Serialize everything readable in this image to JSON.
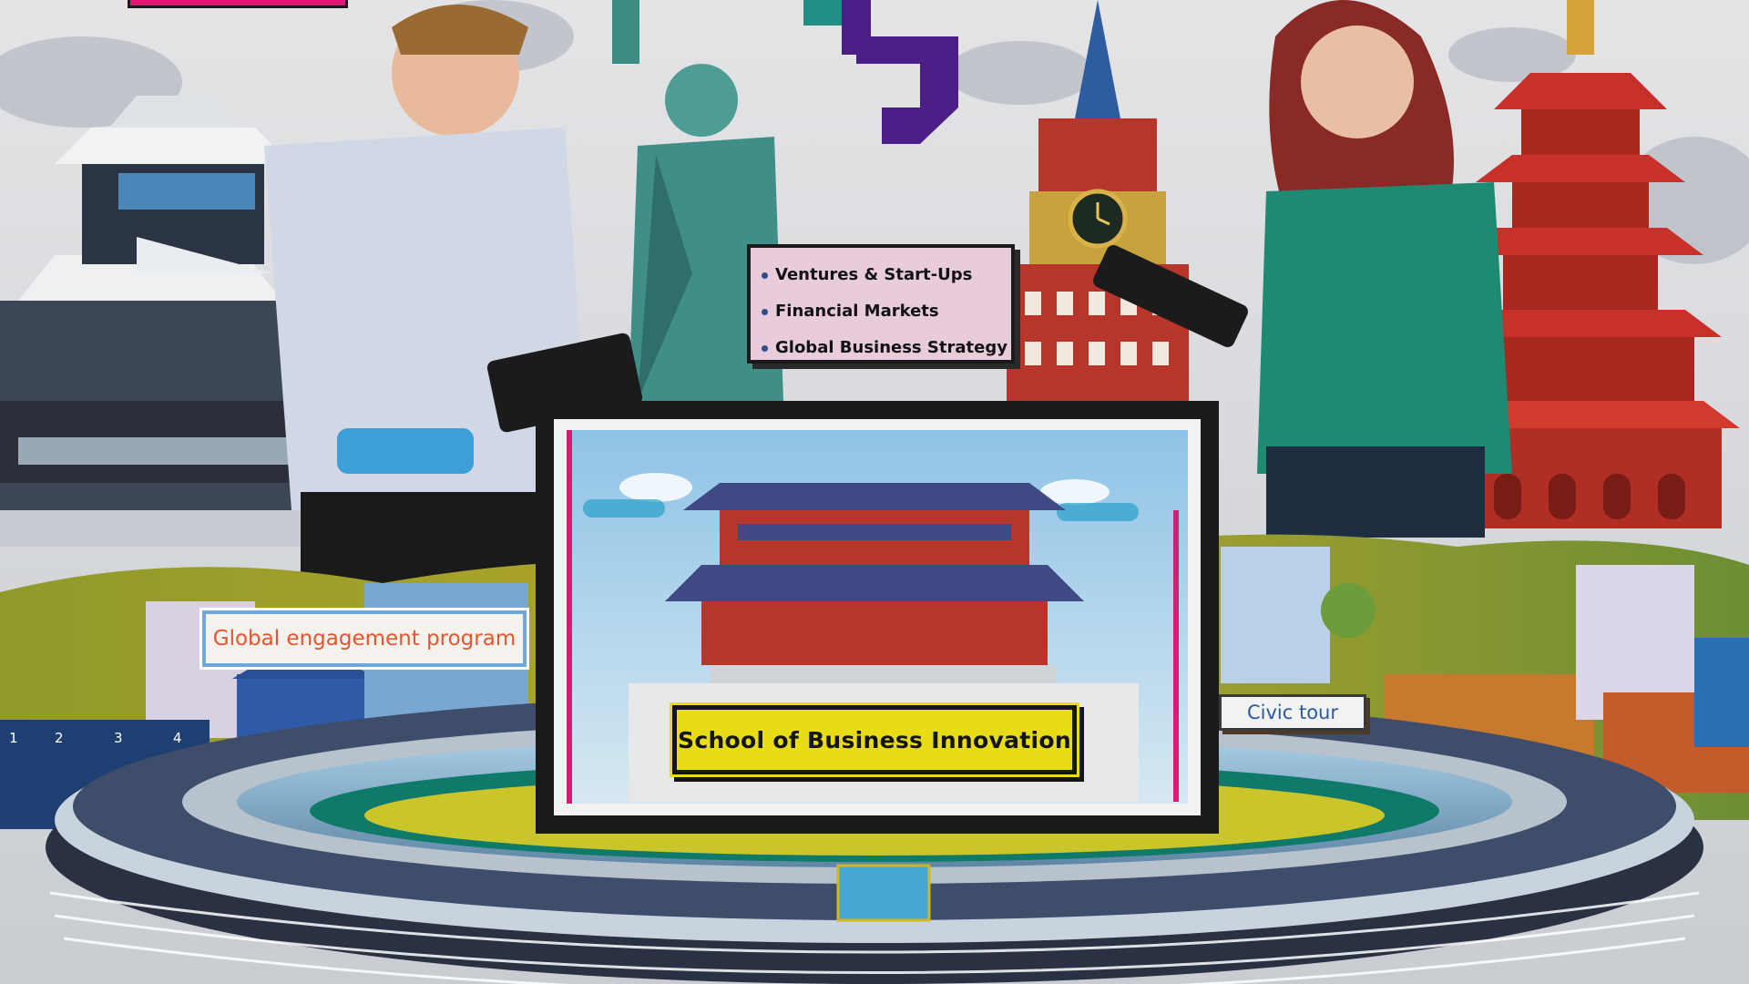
{
  "topics": {
    "items": [
      "Ventures & Start-Ups",
      "Financial Markets",
      "Global Business Strategy"
    ]
  },
  "labels": {
    "global_engagement": "Global engagement program",
    "civic_tour": "Civic tour",
    "school_title": "School of Business Innovation"
  },
  "signage": {
    "gate_numbers": [
      "1",
      "2",
      "3",
      "4"
    ]
  },
  "colors": {
    "logo_purple": "#4b1f86",
    "logo_teal": "#1f8f86",
    "banner_yellow": "#e8dc17",
    "card_pink": "#e9ccdc",
    "accent_magenta": "#d81b74"
  },
  "icons": [
    "logo-mark",
    "bullet-dot",
    "clock-icon",
    "tablet-device"
  ]
}
